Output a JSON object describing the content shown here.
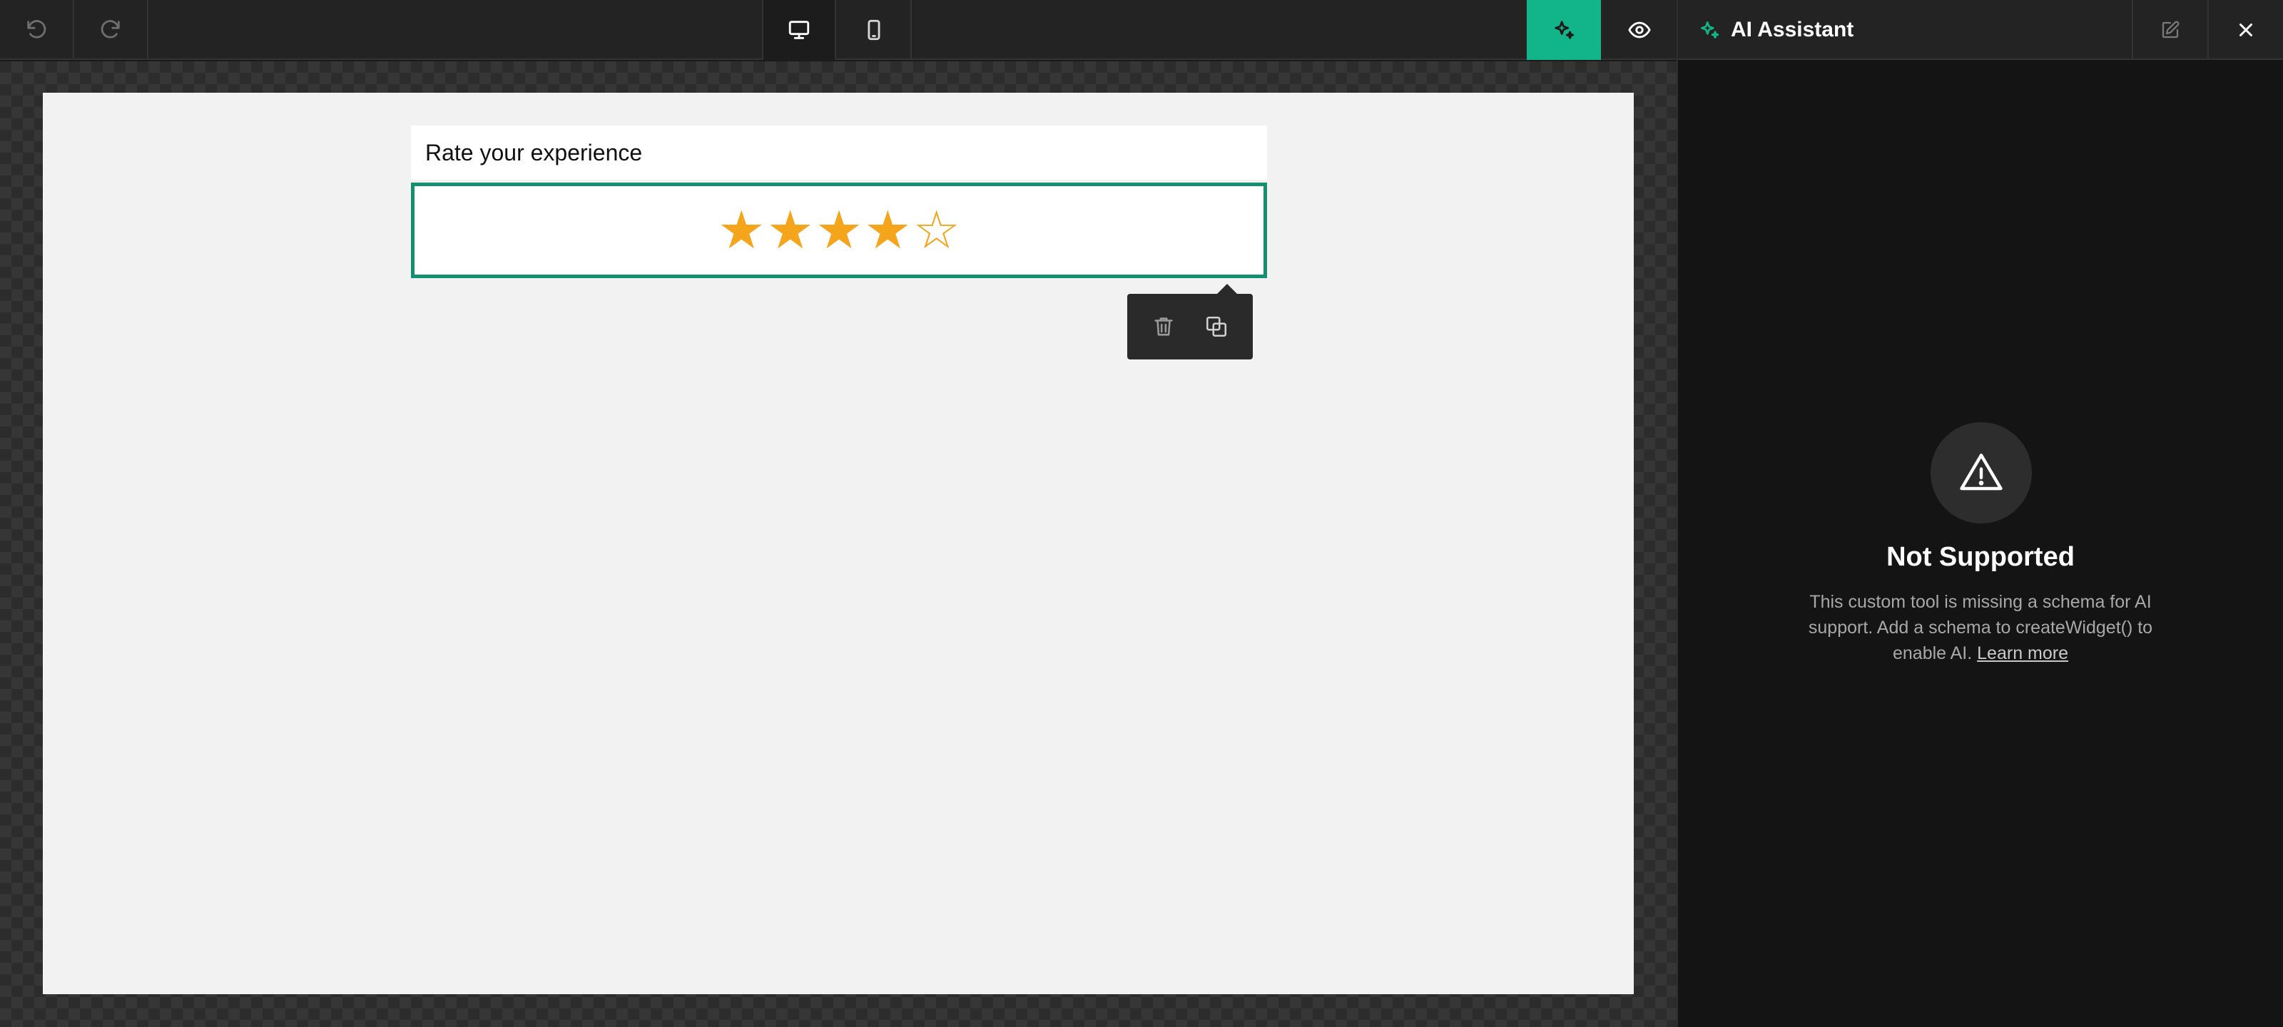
{
  "toolbar": {
    "undo_icon": "undo-icon",
    "redo_icon": "redo-icon",
    "desktop_icon": "desktop-icon",
    "mobile_icon": "mobile-icon",
    "ai_icon": "sparkles-icon",
    "preview_icon": "eye-icon"
  },
  "editor": {
    "heading": "Rate your experience",
    "rating": {
      "value": 4,
      "max": 5,
      "stars": [
        "★",
        "★",
        "★",
        "★",
        "☆"
      ],
      "color": "#f4a51c"
    },
    "selection_color": "#139070",
    "block_actions": {
      "delete_icon": "trash-icon",
      "duplicate_icon": "duplicate-icon"
    }
  },
  "ai_panel": {
    "title": "AI Assistant",
    "edit_icon": "edit-icon",
    "close_icon": "close-icon",
    "warning_icon": "warning-triangle-icon",
    "status_title": "Not Supported",
    "message": "This custom tool is missing a schema for AI support. Add a schema to createWidget() to enable AI.",
    "learn_more": "Learn more"
  },
  "colors": {
    "accent": "#12b48a",
    "toolbar_bg": "#232323",
    "panel_bg": "#141414"
  }
}
